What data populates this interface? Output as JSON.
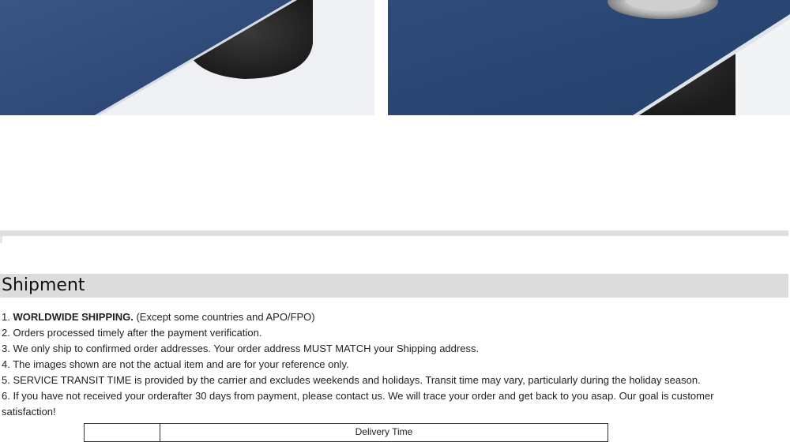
{
  "product_images": [
    {
      "name": "detail-photo-left",
      "icon": "product-photo-icon"
    },
    {
      "name": "detail-photo-right",
      "icon": "product-photo-icon"
    }
  ],
  "shipment": {
    "title": "Shipment",
    "items": [
      {
        "num": "1.",
        "bold": "WORLDWIDE SHIPPING.",
        "text": " (Except some countries and APO/FPO)"
      },
      {
        "num": "2.",
        "bold": "",
        "text": " Orders processed timely after the payment verification."
      },
      {
        "num": "3.",
        "bold": "",
        "text": " We only ship to confirmed order addresses. Your order address MUST MATCH your Shipping address."
      },
      {
        "num": "4.",
        "bold": "",
        "text": " The images shown are not the actual item and are for your reference only."
      },
      {
        "num": "5.",
        "bold": "",
        "text": " SERVICE TRANSIT TIME is provided by the carrier and excludes weekends and holidays. Transit time may vary, particularly during the holiday season."
      },
      {
        "num": "6.",
        "bold": "",
        "text": " If you have not received your orderafter 30 days from payment, please contact us. We will trace your order and get back to   you asap. Our goal is customer satisfaction!"
      }
    ],
    "table_header": "Delivery Time"
  }
}
